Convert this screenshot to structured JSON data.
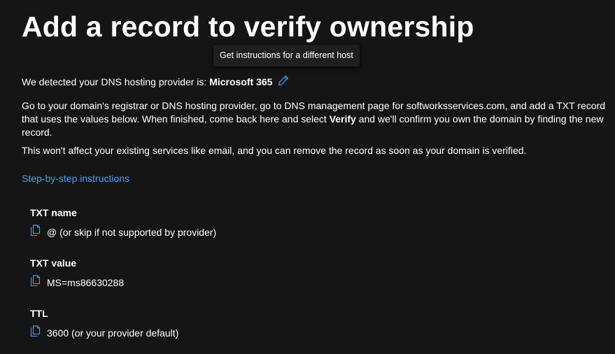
{
  "page": {
    "title": "Add a record to verify ownership",
    "tooltip": "Get instructions for a different host",
    "detected_prefix": "We detected your DNS hosting provider is: ",
    "provider_name": "Microsoft 365",
    "instructions_part1": "Go to your domain's registrar or DNS hosting provider, go to DNS management page for softworksservices.com, and add a TXT record that uses the values below. When finished, come back here and select ",
    "instructions_verify": "Verify",
    "instructions_part2": " and we'll confirm you own the domain by finding the new record.",
    "note": "This won't affect your existing services like email, and you can remove the record as soon as your domain is verified.",
    "step_link": "Step-by-step instructions"
  },
  "fields": [
    {
      "label": "TXT name",
      "value": "@ (or skip if not supported by provider)"
    },
    {
      "label": "TXT value",
      "value": "MS=ms86630288"
    },
    {
      "label": "TTL",
      "value": "3600 (or your provider default)"
    }
  ],
  "icons": {
    "edit": "pencil-icon",
    "copy": "copy-icon"
  },
  "colors": {
    "background": "#151515",
    "text": "#ffffff",
    "link": "#479ef5",
    "icon_accent": "#479ef5"
  }
}
